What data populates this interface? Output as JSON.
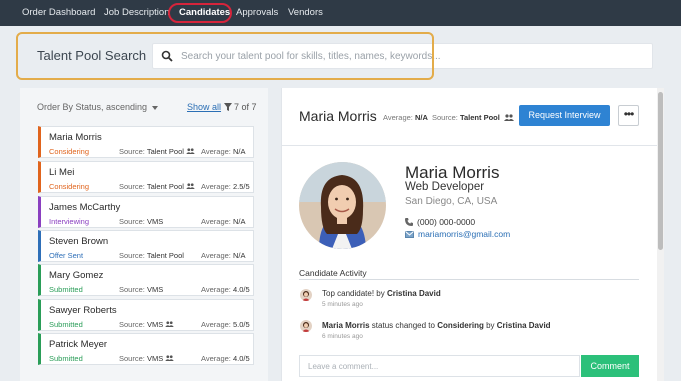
{
  "nav": {
    "tabs": [
      {
        "label": "Order Dashboard"
      },
      {
        "label": "Job Description"
      },
      {
        "label": "Candidates"
      },
      {
        "label": "Approvals"
      },
      {
        "label": "Vendors"
      }
    ],
    "active_tab": "Candidates"
  },
  "search": {
    "label": "Talent Pool Search",
    "placeholder": "Search your talent pool for skills, titles, names, keywords..."
  },
  "list": {
    "order_by": "Order By Status, ascending",
    "show_all": "Show all",
    "count": "7 of 7",
    "source_label": "Source:",
    "average_label": "Average:",
    "candidates": [
      {
        "name": "Maria Morris",
        "status": "Considering",
        "status_color": "#e0641d",
        "source": "Talent Pool",
        "pool_icon": true,
        "average": "N/A"
      },
      {
        "name": "Li Mei",
        "status": "Considering",
        "status_color": "#e0641d",
        "source": "Talent Pool",
        "pool_icon": true,
        "average": "2.5/5"
      },
      {
        "name": "James McCarthy",
        "status": "Interviewing",
        "status_color": "#8a3fc0",
        "source": "VMS",
        "pool_icon": false,
        "average": "N/A"
      },
      {
        "name": "Steven Brown",
        "status": "Offer Sent",
        "status_color": "#2e6fb8",
        "source": "Talent Pool",
        "pool_icon": false,
        "average": "N/A"
      },
      {
        "name": "Mary Gomez",
        "status": "Submitted",
        "status_color": "#2a9d58",
        "source": "VMS",
        "pool_icon": false,
        "average": "4.0/5"
      },
      {
        "name": "Sawyer Roberts",
        "status": "Submitted",
        "status_color": "#2a9d58",
        "source": "VMS",
        "pool_icon": true,
        "average": "5.0/5"
      },
      {
        "name": "Patrick Meyer",
        "status": "Submitted",
        "status_color": "#2a9d58",
        "source": "VMS",
        "pool_icon": true,
        "average": "4.0/5"
      }
    ]
  },
  "detail": {
    "header_name": "Maria Morris",
    "average_label": "Average:",
    "average": "N/A",
    "source_label": "Source:",
    "source": "Talent Pool",
    "request_button": "Request Interview",
    "more_button": "•••",
    "name": "Maria Morris",
    "title": "Web Developer",
    "location": "San Diego, CA, USA",
    "phone": "(000) 000-0000",
    "email": "mariamorris@gmail.com"
  },
  "activity": {
    "title": "Candidate Activity",
    "items": [
      {
        "prefix": "Top candidate! by ",
        "actor": "Cristina David",
        "time": "5 minutes ago"
      },
      {
        "subject": "Maria Morris",
        "middle": " status changed to ",
        "status": "Considering",
        "by": " by ",
        "actor": "Cristina David",
        "time": "6 minutes ago"
      }
    ],
    "comment_placeholder": "Leave a comment...",
    "comment_button": "Comment"
  },
  "colors": {
    "nav_bg": "#2f3a46",
    "highlight_red": "#d6243b",
    "highlight_orange": "#e3ac4a",
    "primary_blue": "#2e83d3",
    "comment_green": "#2cc07a"
  }
}
